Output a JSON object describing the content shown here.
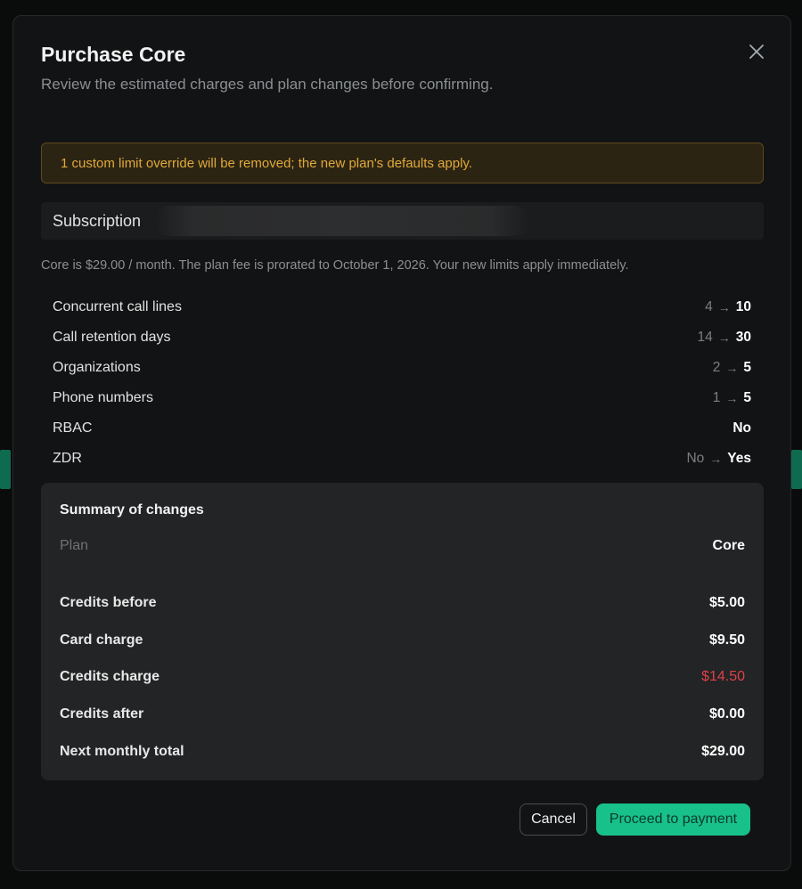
{
  "modal": {
    "title": "Purchase Core",
    "subtitle": "Review the estimated charges and plan changes before confirming."
  },
  "warning": {
    "text": "1 custom limit override will be removed; the new plan's defaults apply."
  },
  "subscription": {
    "label": "Subscription"
  },
  "note": "Core is $29.00 / month. The plan fee is prorated to October 1, 2026. Your new limits apply immediately.",
  "limits": [
    {
      "name": "Concurrent call lines",
      "old": "4",
      "arrow": "→",
      "new": "10"
    },
    {
      "name": "Call retention days",
      "old": "14",
      "arrow": "→",
      "new": "30"
    },
    {
      "name": "Organizations",
      "old": "2",
      "arrow": "→",
      "new": "5"
    },
    {
      "name": "Phone numbers",
      "old": "1",
      "arrow": "→",
      "new": "5"
    },
    {
      "name": "RBAC",
      "old": "",
      "arrow": "",
      "new": "No"
    },
    {
      "name": "ZDR",
      "old": "No",
      "arrow": "→",
      "new": "Yes"
    }
  ],
  "summary": {
    "title": "Summary of changes",
    "plan": {
      "label": "Plan",
      "value": "Core"
    },
    "rows": [
      {
        "label": "Credits before",
        "value": "$5.00"
      },
      {
        "label": "Card charge",
        "value": "$9.50"
      },
      {
        "label": "Credits charge",
        "value": "$14.50"
      },
      {
        "label": "Credits after",
        "value": "$0.00"
      },
      {
        "label": "Next monthly total",
        "value": "$29.00"
      }
    ]
  },
  "buttons": {
    "cancel": "Cancel",
    "proceed": "Proceed to payment"
  },
  "icons": {
    "close": "close-icon",
    "arrow": "arrow-right-icon"
  },
  "colors": {
    "accent": "#18c08a",
    "warning_text": "#e0a93a",
    "negative": "#e0404a"
  }
}
